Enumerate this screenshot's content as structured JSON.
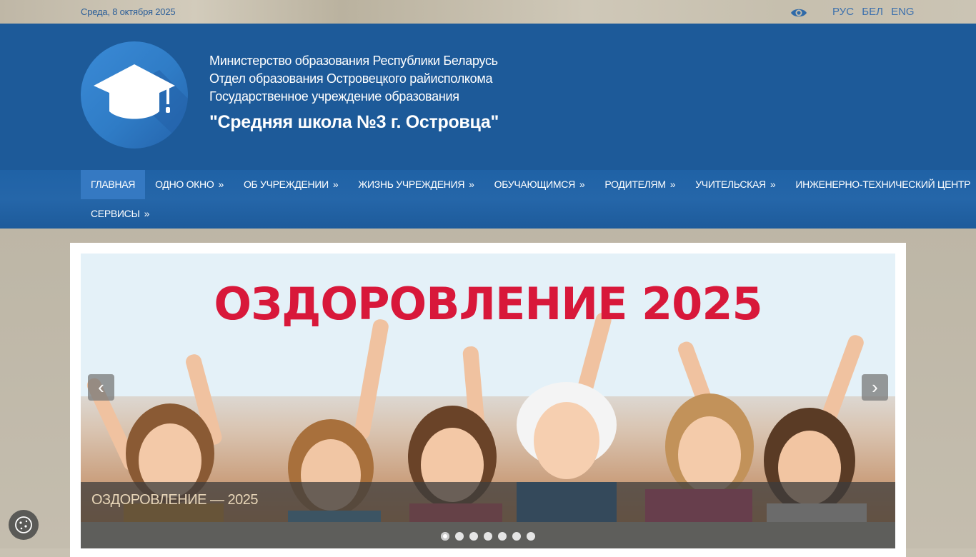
{
  "topbar": {
    "date": "Среда, 8 октября 2025",
    "accessibility_icon": "eye-icon",
    "languages": [
      "РУС",
      "БЕЛ",
      "ENG"
    ]
  },
  "header": {
    "logo_icon": "graduation-cap-icon",
    "line1": "Министерство образования Республики Беларусь",
    "line2": "Отдел образования Островецкого райисполкома",
    "line3": "Государственное учреждение образования",
    "school_name": "\"Средняя школа №3 г. Островца\""
  },
  "nav": {
    "row1": [
      {
        "label": "ГЛАВНАЯ",
        "arrow": ""
      },
      {
        "label": "ОДНО ОКНО",
        "arrow": "»"
      },
      {
        "label": "ОБ УЧРЕЖДЕНИИ",
        "arrow": "»"
      },
      {
        "label": "ЖИЗНЬ УЧРЕЖДЕНИЯ",
        "arrow": "»"
      },
      {
        "label": "ОБУЧАЮЩИМСЯ",
        "arrow": "»"
      },
      {
        "label": "РОДИТЕЛЯМ",
        "arrow": "»"
      },
      {
        "label": "УЧИТЕЛЬСКАЯ",
        "arrow": "»"
      },
      {
        "label": "ИНЖЕНЕРНО-ТЕХНИЧЕСКИЙ ЦЕНТР",
        "arrow": ""
      }
    ],
    "row2": [
      {
        "label": "СЕРВИСЫ",
        "arrow": "»"
      }
    ],
    "active_index": 0
  },
  "slider": {
    "banner_text": "ОЗДОРОВЛЕНИЕ 2025",
    "caption": "ОЗДОРОВЛЕНИЕ — 2025",
    "prev_symbol": "‹",
    "next_symbol": "›",
    "dot_count": 7,
    "active_dot": 0
  },
  "colors": {
    "header_bg": "#1d5a99",
    "nav_bg": "#2566a9",
    "active_nav": "#3579c2",
    "banner_red": "#d8183a",
    "link_blue": "#2c5f99"
  },
  "cookie_icon": "cookie-icon"
}
